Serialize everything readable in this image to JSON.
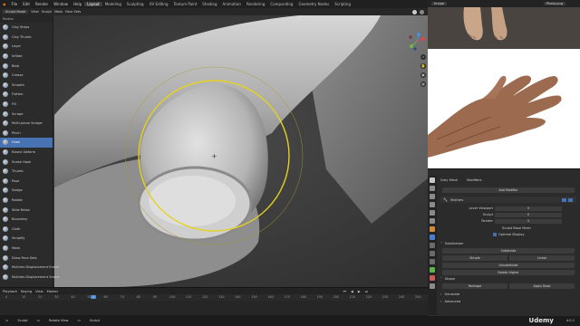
{
  "menubar": {
    "items": [
      "File",
      "Edit",
      "Render",
      "Window",
      "Help"
    ],
    "workspaces": [
      "Layout",
      "Modeling",
      "Sculpting",
      "UV Editing",
      "Texture Paint",
      "Shading",
      "Animation",
      "Rendering",
      "Compositing",
      "Geometry Nodes",
      "Scripting"
    ],
    "active_workspace": "Layout"
  },
  "viewport_header": {
    "mode": "Sculpt Mode",
    "items": [
      "View",
      "Sculpt",
      "Mask",
      "Face Sets"
    ]
  },
  "toolbar": {
    "title": "Radius",
    "tools": [
      "Clay Strips",
      "Clay Thumb",
      "Layer",
      "Inflate",
      "Blob",
      "Crease",
      "Smooth",
      "Flatten",
      "Fill",
      "Scrape",
      "Multi-plane Scrape",
      "Pinch",
      "Grab",
      "Elastic Deform",
      "Snake Hook",
      "Thumb",
      "Pose",
      "Nudge",
      "Rotate",
      "Slide Relax",
      "Boundary",
      "Cloth",
      "Simplify",
      "Mask",
      "Draw Face Sets",
      "Multires Displacement Eraser",
      "Multires Displacement Smear"
    ],
    "active_tool": "Grab"
  },
  "timeline": {
    "menus": [
      "Playback",
      "Keying",
      "View",
      "Marker"
    ],
    "ticks": [
      "0",
      "10",
      "20",
      "30",
      "40",
      "50",
      "60",
      "70",
      "80",
      "90",
      "100",
      "110",
      "120",
      "130",
      "140",
      "150",
      "160",
      "170",
      "180",
      "190",
      "200",
      "210",
      "220",
      "230",
      "240",
      "250"
    ],
    "frame": "1"
  },
  "status_bar": {
    "items": [
      "Sculpt",
      "Rotate View",
      "Sculpt"
    ],
    "brand": "Udemy",
    "version": "4.0.1"
  },
  "ref_image_header": {
    "items": [
      "Image",
      "Photo.png"
    ]
  },
  "properties": {
    "object_name": "Grey Mesh",
    "modifier_tab": "Modifiers",
    "add_modifier": "Add Modifier",
    "modifier_name": "Multires",
    "fields": [
      {
        "label": "Level Viewport",
        "value": "5"
      },
      {
        "label": "Sculpt",
        "value": "5"
      },
      {
        "label": "Render",
        "value": "5"
      }
    ],
    "sculpt_base_mesh": "Sculpt Base Mesh",
    "optimal_display": "Optimal Display",
    "subdivision_label": "Subdivision",
    "subdivide": "Subdivide",
    "simple": "Simple",
    "linear": "Linear",
    "unsubdivide": "Unsubdivide",
    "delete_higher": "Delete Higher",
    "shape_label": "Shape",
    "reshape": "Reshape",
    "apply_base": "Apply Base",
    "generate_label": "Generate",
    "advanced_label": "Advanced"
  },
  "colors": {
    "accent": "#4772b3",
    "brush_circle": "#e6d21e",
    "panel": "#2b2b2b"
  }
}
